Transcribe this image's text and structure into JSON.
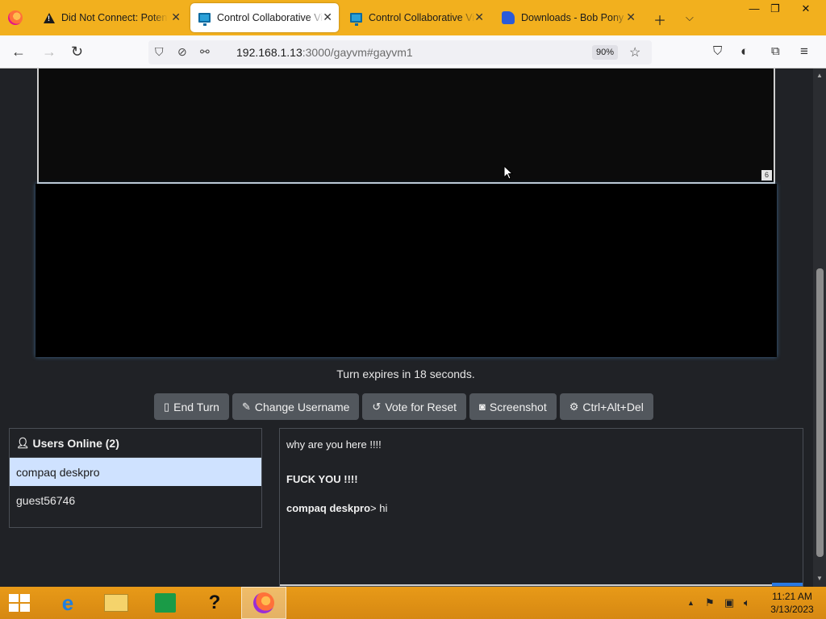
{
  "browser": {
    "tabs": [
      {
        "title": "Did Not Connect: Potent",
        "icon": "warning-icon",
        "active": false
      },
      {
        "title": "Control Collaborative Vir",
        "icon": "monitor-icon",
        "active": true
      },
      {
        "title": "Control Collaborative Vir",
        "icon": "monitor-icon",
        "active": false
      },
      {
        "title": "Downloads - Bob Pony",
        "icon": "pony-icon",
        "active": false
      }
    ],
    "url_host": "192.168.1.13",
    "url_path": ":3000/gayvm#gayvm1",
    "zoom": "90%"
  },
  "vm": {
    "top_badge": "6"
  },
  "turn_text": "Turn expires in 18 seconds.",
  "buttons": {
    "end_turn": "End Turn",
    "change_username": "Change Username",
    "vote_reset": "Vote for Reset",
    "screenshot": "Screenshot",
    "ctrl_alt_del": "Ctrl+Alt+Del"
  },
  "users": {
    "header": "Users Online (2)",
    "list": [
      "compaq deskpro",
      "guest56746"
    ]
  },
  "chat": {
    "messages": [
      {
        "user": "",
        "text": "why are you here !!!!"
      },
      {
        "user": "",
        "text": "FUCK YOU !!!!"
      },
      {
        "user": "compaq deskpro",
        "text": "> hi"
      }
    ]
  },
  "taskbar": {
    "time": "11:21 AM",
    "date": "3/13/2023"
  },
  "colors": {
    "tabstrip": "#f2b01e",
    "page_bg": "#202226",
    "button_bg": "#52575d",
    "selected_user_bg": "#cfe2ff",
    "taskbar": "#e89a18"
  }
}
